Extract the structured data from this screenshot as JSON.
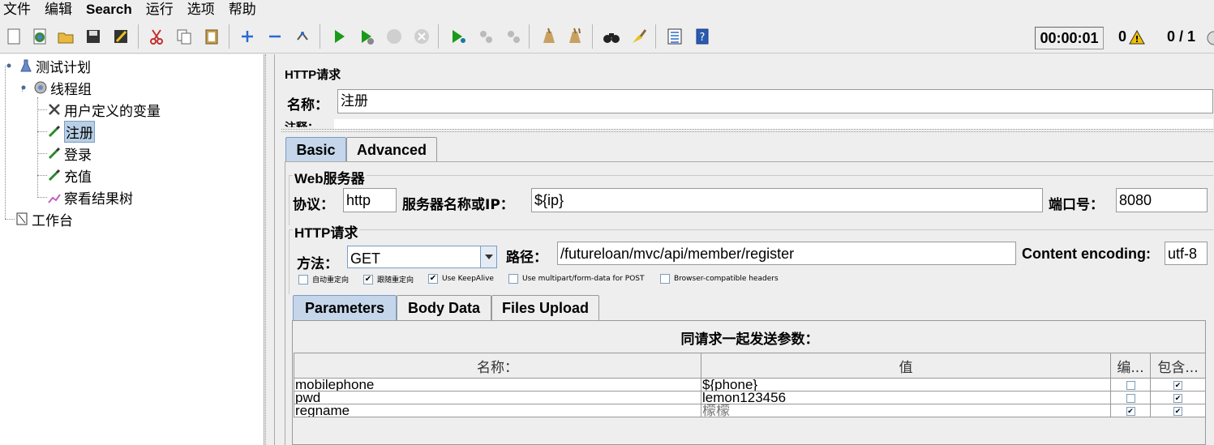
{
  "menu": [
    "文件",
    "编辑",
    "Search",
    "运行",
    "选项",
    "帮助"
  ],
  "toolbar": {
    "icons": [
      "new-icon",
      "templates-icon",
      "open-icon",
      "save-icon",
      "save-as-icon",
      "cut-icon",
      "copy-icon",
      "paste-icon",
      "expand-icon",
      "collapse-icon",
      "toggle-icon",
      "start-icon",
      "start-no-pause-icon",
      "stop-icon",
      "shutdown-icon",
      "remote-start-icon",
      "remote-stop-icon",
      "remote-shutdown-icon",
      "clear-icon",
      "clear-all-icon",
      "search-icon",
      "reset-search-icon",
      "function-helper-icon",
      "help-icon"
    ],
    "timer": "00:00:01",
    "warning_count": "0",
    "threads": "0 / 1"
  },
  "tree": {
    "test_plan": "测试计划",
    "thread_group": "线程组",
    "children": [
      "用户定义的变量",
      "注册",
      "登录",
      "充值",
      "察看结果树"
    ],
    "selected": "注册",
    "workbench": "工作台"
  },
  "sampler": {
    "title": "HTTP请求",
    "name_label": "名称：",
    "name_value": "注册",
    "comment_label": "注释："
  },
  "tabs": [
    "Basic",
    "Advanced"
  ],
  "web_server": {
    "group_title": "Web服务器",
    "protocol_label": "协议：",
    "protocol_value": "http",
    "server_label": "服务器名称或IP：",
    "server_value": "${ip}",
    "port_label": "端口号：",
    "port_value": "8080"
  },
  "http_request": {
    "group_title": "HTTP请求",
    "method_label": "方法：",
    "method_value": "GET",
    "path_label": "路径：",
    "path_value": "/futureloan/mvc/api/member/register",
    "encoding_label": "Content encoding:",
    "encoding_value": "utf-8",
    "options": [
      {
        "label": "自动重定向",
        "checked": false
      },
      {
        "label": "跟随重定向",
        "checked": true
      },
      {
        "label": "Use KeepAlive",
        "checked": true
      },
      {
        "label": "Use multipart/form-data for POST",
        "checked": false
      },
      {
        "label": "Browser-compatible headers",
        "checked": false
      }
    ]
  },
  "param_tabs": [
    "Parameters",
    "Body Data",
    "Files Upload"
  ],
  "params": {
    "title": "同请求一起发送参数：",
    "headers": [
      "名称：",
      "值",
      "编...",
      "包含..."
    ],
    "rows": [
      {
        "name": "mobilephone",
        "value": "${phone}",
        "encode": false,
        "include": true
      },
      {
        "name": "pwd",
        "value": "lemon123456",
        "encode": false,
        "include": true
      },
      {
        "name": "regname",
        "value": "檬檬",
        "encode": true,
        "include": true
      }
    ]
  }
}
